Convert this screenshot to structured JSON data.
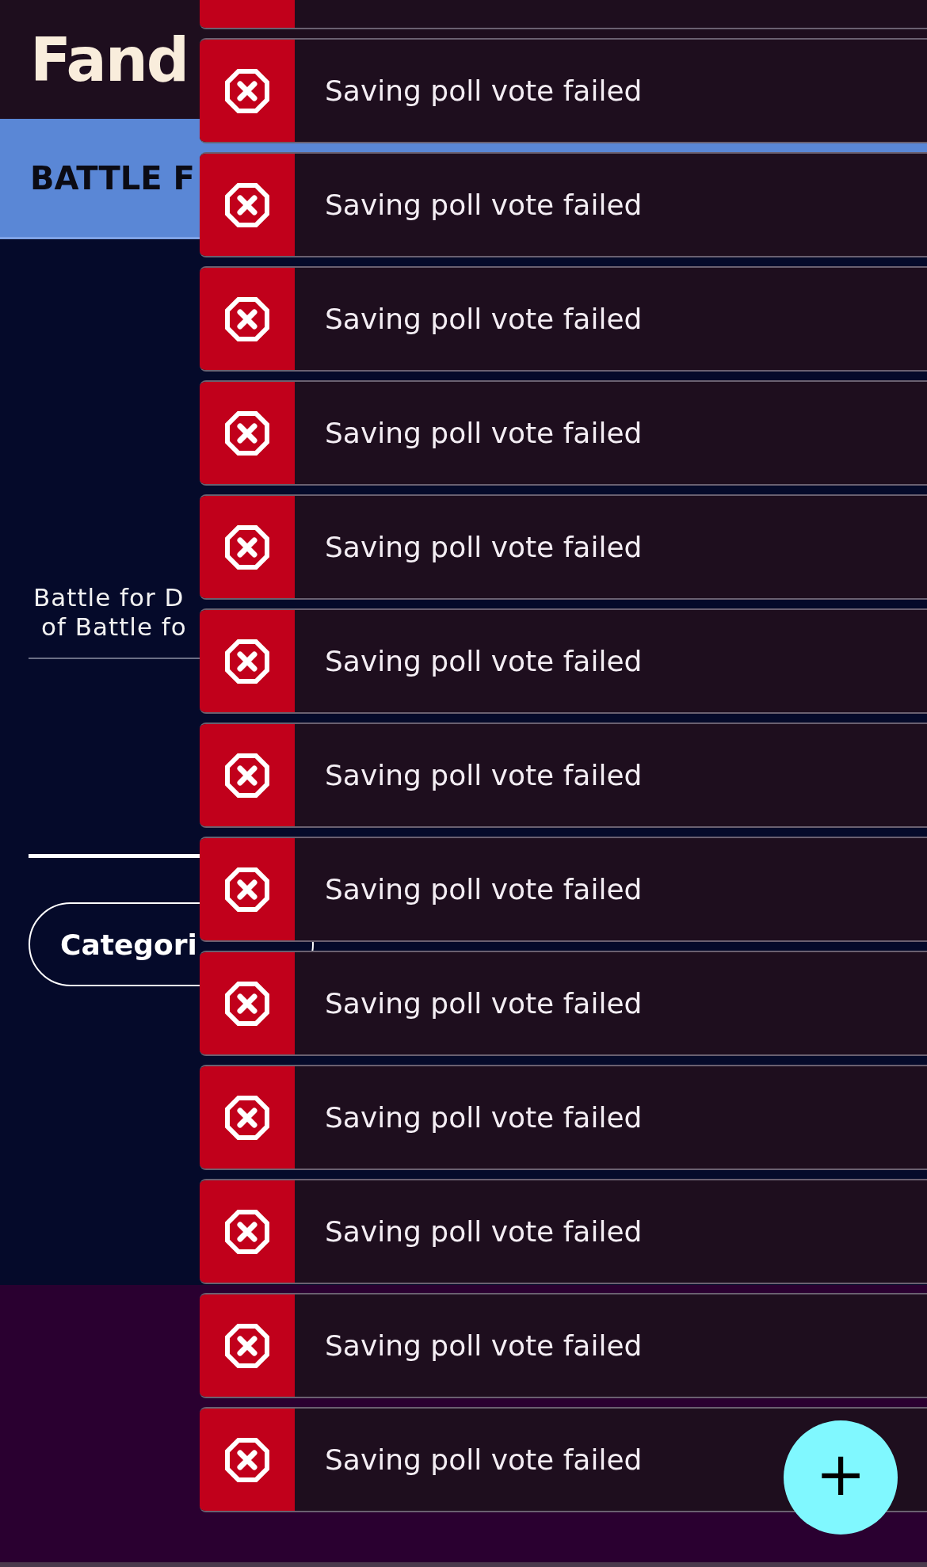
{
  "header": {
    "logo": "Fand"
  },
  "banner": {
    "title": "BATTLE F"
  },
  "intro": {
    "lines": [
      "Battle for D",
      "of Battle fo"
    ]
  },
  "categories_button": {
    "label": "Categori"
  },
  "toasts": [
    {
      "kind": "clipped"
    },
    {
      "kind": "error",
      "message": "Saving poll vote failed"
    },
    {
      "kind": "error",
      "message": "Saving poll vote failed"
    },
    {
      "kind": "error",
      "message": "Saving poll vote failed"
    },
    {
      "kind": "error",
      "message": "Saving poll vote failed"
    },
    {
      "kind": "error",
      "message": "Saving poll vote failed"
    },
    {
      "kind": "error",
      "message": "Saving poll vote failed"
    },
    {
      "kind": "error",
      "message": "Saving poll vote failed"
    },
    {
      "kind": "error",
      "message": "Saving poll vote failed"
    },
    {
      "kind": "error",
      "message": "Saving poll vote failed"
    },
    {
      "kind": "error",
      "message": "Saving poll vote failed"
    },
    {
      "kind": "error",
      "message": "Saving poll vote failed"
    },
    {
      "kind": "error",
      "message": "Saving poll vote failed"
    },
    {
      "kind": "error",
      "message": "Saving poll vote failed"
    }
  ],
  "fab": {
    "label": "+"
  }
}
